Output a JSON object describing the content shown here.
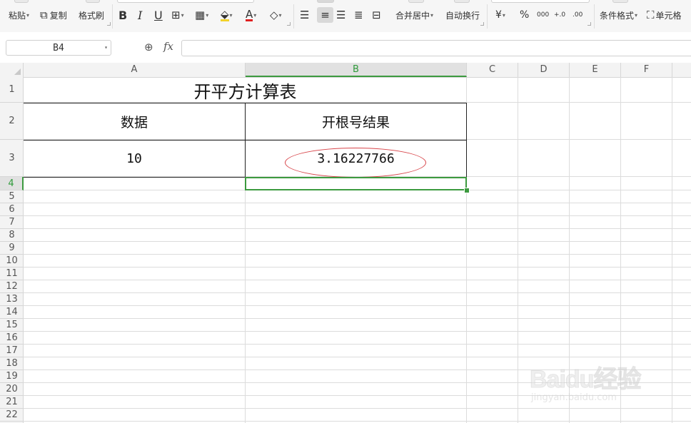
{
  "ribbon": {
    "paste_label": "粘贴",
    "copy_label": "复制",
    "format_painter_label": "格式刷",
    "bold_label": "B",
    "italic_label": "I",
    "underline_label": "U",
    "font_color_label": "A",
    "merge_center_label": "合并居中",
    "wrap_text_label": "自动换行",
    "currency_label": "¥",
    "percent_label": "%",
    "thousands_label": "000",
    "dec_increase_label": "+.0",
    "dec_decrease_label": ".00",
    "cond_format_label": "条件格式",
    "cell_style_label": "单元格"
  },
  "formula_bar": {
    "name_box": "B4",
    "fx_label": "fx",
    "formula": ""
  },
  "columns": [
    "A",
    "B",
    "C",
    "D",
    "E",
    "F"
  ],
  "rows": [
    "1",
    "2",
    "3",
    "4",
    "5",
    "6",
    "7",
    "8",
    "9",
    "10",
    "11",
    "12",
    "13",
    "14",
    "15",
    "16",
    "17",
    "18",
    "19",
    "20",
    "21",
    "22"
  ],
  "cells": {
    "title": "开平方计算表",
    "a2": "数据",
    "b2": "开根号结果",
    "a3": "10",
    "b3": "3.16227766"
  },
  "selection": {
    "active_cell": "B4",
    "active_column": "B",
    "active_row": "4"
  },
  "watermark": {
    "main": "Baidu经验",
    "sub": "jingyan.baidu.com"
  },
  "colors": {
    "selection": "#3c9a3f",
    "annotation": "#d8454a"
  }
}
